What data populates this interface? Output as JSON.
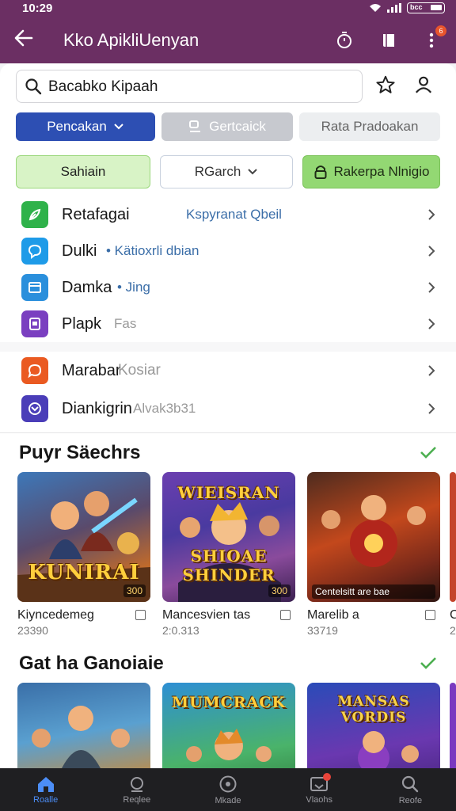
{
  "status_bar": {
    "time": "10:29",
    "battery_label": "bcc"
  },
  "app_bar": {
    "title": "Kko ApikliUenyan",
    "notification_count": "6"
  },
  "search": {
    "query": "Bacabko Kipaah"
  },
  "chips_row1": {
    "primary": "Pencakan",
    "grey": "Gertcaick",
    "light": "Rata Pradoakan"
  },
  "chips_row2": {
    "left": "Sahiain",
    "middle": "RGarch",
    "right": "Rakerpa Nlnigio"
  },
  "list": [
    {
      "label": "Retafagai",
      "sub": "Kspyranat Qbeil",
      "icon": "leaf-icon",
      "color": "#2fb24a"
    },
    {
      "label": "Dulki",
      "sub": "• Kätioxrli dbian",
      "icon": "chat-bubble-icon",
      "color": "#1e9be8"
    },
    {
      "label": "Damka",
      "sub": "• Jing",
      "icon": "window-icon",
      "color": "#2a8fdc"
    },
    {
      "label": "Plapk",
      "sub": "Fas",
      "icon": "document-icon",
      "color": "#7a3fc0"
    },
    {
      "label": "Marabar",
      "sub": "Kosiar",
      "icon": "speech-icon",
      "color": "#ea5a21"
    },
    {
      "label": "Diankigrin",
      "sub": "Alvak3b31",
      "icon": "envelope-icon",
      "color": "#4a3db8"
    }
  ],
  "section1": {
    "title": "Puyr Säechrs",
    "cards": [
      {
        "name": "Kiyncedemeg",
        "count": "23390",
        "logo": "KUNIRAI",
        "tag": "300"
      },
      {
        "name": "Mancesvien tas",
        "count": "2:0.313",
        "logo": "SHIOAE SHINDER",
        "logo_top": "WIEISRAN",
        "tag": "300"
      },
      {
        "name": "Marelib a",
        "count": "33719",
        "logo": "",
        "tag_wide": "Centelsitt are bae"
      }
    ],
    "peek_card": {
      "name": "C",
      "count": "2"
    }
  },
  "section2": {
    "title": "Gat ha Ganoiaie",
    "cards": [
      {
        "logo": ""
      },
      {
        "logo": "MUMCRACK"
      },
      {
        "logo": "MANSAS VORDIS"
      }
    ]
  },
  "bottom_nav": [
    {
      "label": "Roalle",
      "icon": "home-icon",
      "active": true
    },
    {
      "label": "Reqlee",
      "icon": "chat-icon"
    },
    {
      "label": "Mkade",
      "icon": "circle-icon"
    },
    {
      "label": "Vlaohs",
      "icon": "inbox-icon",
      "badge": true
    },
    {
      "label": "Reofe",
      "icon": "search-icon"
    }
  ]
}
